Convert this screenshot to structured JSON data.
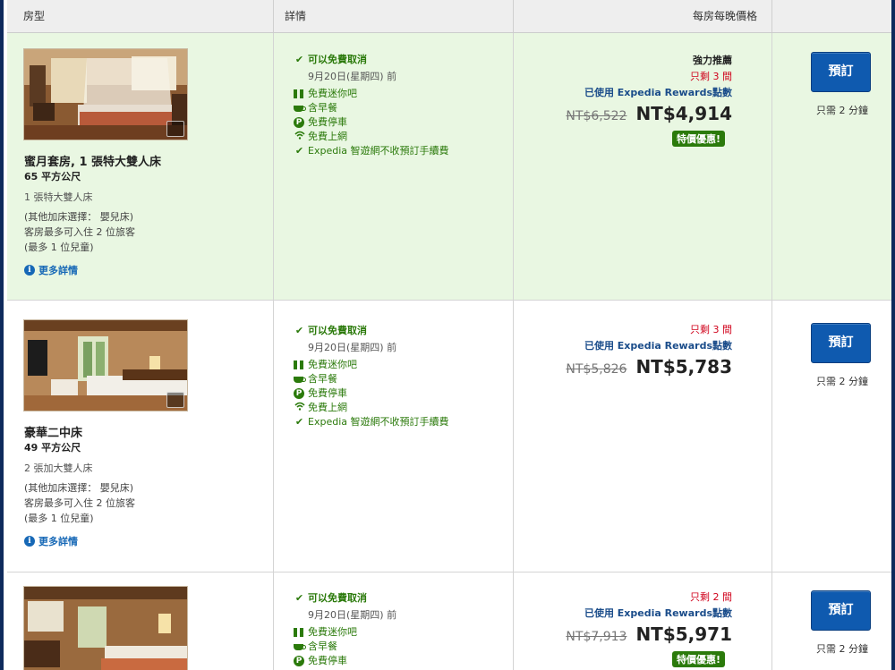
{
  "header": {
    "col_room": "房型",
    "col_details": "詳情",
    "col_price": "每房每晚價格",
    "col_book": ""
  },
  "rooms": [
    {
      "name": "蜜月套房, 1 張特大雙人床",
      "size": "65 平方公尺",
      "bed": "1 張特大雙人床",
      "extra_bed": "(其他加床選擇： 嬰兒床)",
      "max_guests": "客房最多可入住 2 位旅客",
      "max_children": "(最多 1 位兒童)",
      "more_details": "更多詳情",
      "free_cancel": "可以免費取消",
      "cancel_deadline": "9月20日(星期四) 前",
      "amenities": [
        "免費迷你吧",
        "含早餐",
        "免費停車",
        "免費上網",
        "Expedia 智遊網不收預訂手續費"
      ],
      "recommended": "強力推薦",
      "rooms_left": "只剩 3 間",
      "rewards": "已使用 Expedia Rewards點數",
      "old_price": "NT$6,522",
      "price": "NT$4,914",
      "deal_badge": "特價優惠!",
      "book_label": "預訂",
      "book_note": "只需 2 分鐘"
    },
    {
      "name": "豪華二中床",
      "size": "49 平方公尺",
      "bed": "2 張加大雙人床",
      "extra_bed": "(其他加床選擇： 嬰兒床)",
      "max_guests": "客房最多可入住 2 位旅客",
      "max_children": "(最多 1 位兒童)",
      "more_details": "更多詳情",
      "free_cancel": "可以免費取消",
      "cancel_deadline": "9月20日(星期四) 前",
      "amenities": [
        "免費迷你吧",
        "含早餐",
        "免費停車",
        "免費上網",
        "Expedia 智遊網不收預訂手續費"
      ],
      "rooms_left": "只剩 3 間",
      "rewards": "已使用 Expedia Rewards點數",
      "old_price": "NT$5,826",
      "price": "NT$5,783",
      "book_label": "預訂",
      "book_note": "只需 2 分鐘"
    },
    {
      "free_cancel": "可以免費取消",
      "cancel_deadline": "9月20日(星期四) 前",
      "amenities": [
        "免費迷你吧",
        "含早餐",
        "免費停車"
      ],
      "rooms_left": "只剩 2 間",
      "rewards": "已使用 Expedia Rewards點數",
      "old_price": "NT$7,913",
      "price": "NT$5,971",
      "deal_badge": "特價優惠!",
      "book_label": "預訂",
      "book_note": "只需 2 分鐘"
    }
  ],
  "colors": {
    "highlight_row": "#e9f7e2",
    "green_text": "#2b7a0b",
    "red_text": "#d0021b",
    "rewards_blue": "#1a4c8a",
    "button_blue": "#0f5aaf",
    "frame_navy": "#0e2a5c"
  },
  "icons": {
    "cancel": "checkmark-icon",
    "minibar": "gift-icon",
    "breakfast": "coffee-cup-icon",
    "parking": "parking-icon",
    "wifi": "wifi-icon",
    "fee": "checkmark-icon",
    "info": "info-icon",
    "gallery": "gallery-icon"
  }
}
